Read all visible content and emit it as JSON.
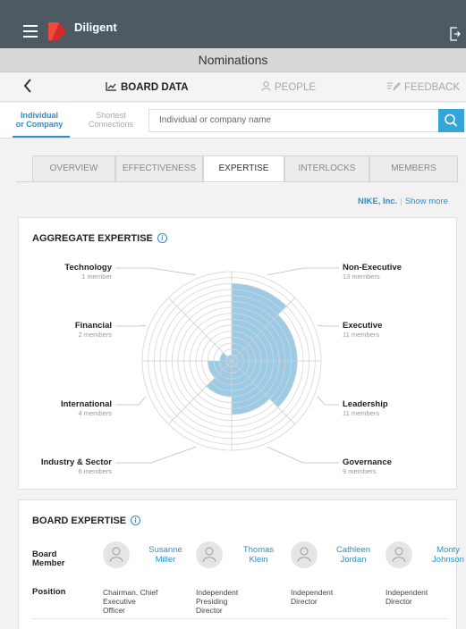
{
  "app": {
    "brand": "Diligent",
    "screen_title": "Nominations"
  },
  "nav": {
    "board_data": "BOARD DATA",
    "people": "PEOPLE",
    "feedback": "FEEDBACK"
  },
  "search": {
    "segment_individual_line1": "Individual",
    "segment_individual_line2": "or Company",
    "segment_shortest_line1": "Shortest",
    "segment_shortest_line2": "Connections",
    "placeholder": "Individual or company name"
  },
  "tabs": [
    "OVERVIEW",
    "EFFECTIVENESS",
    "EXPERTISE",
    "INTERLOCKS",
    "MEMBERS"
  ],
  "active_tab": "EXPERTISE",
  "company": {
    "name": "NIKE, Inc.",
    "separator": "|",
    "show_more": "Show more"
  },
  "aggregate": {
    "title": "AGGREGATE EXPERTISE",
    "info_symbol": "i",
    "ring_count": 15,
    "fill_color": "#9ccbe8",
    "sectors": [
      {
        "name": "Non-Executive",
        "count_text": "13 members",
        "value": 13
      },
      {
        "name": "Executive",
        "count_text": "11 members",
        "value": 11
      },
      {
        "name": "Leadership",
        "count_text": "11 members",
        "value": 11
      },
      {
        "name": "Governance",
        "count_text": "9 members",
        "value": 9
      },
      {
        "name": "Industry & Sector",
        "count_text": "6 members",
        "value": 6
      },
      {
        "name": "International",
        "count_text": "4 members",
        "value": 4
      },
      {
        "name": "Financial",
        "count_text": "2 members",
        "value": 2
      },
      {
        "name": "Technology",
        "count_text": "1 member",
        "value": 1
      }
    ]
  },
  "board": {
    "title": "BOARD EXPERTISE",
    "info_symbol": "i",
    "board_member_label_1": "Board",
    "board_member_label_2": "Member",
    "position_label": "Position",
    "members": [
      {
        "first": "Susanne",
        "last": "Miller",
        "position": [
          "Chairman, Chief",
          "Executive",
          "Officer"
        ]
      },
      {
        "first": "Thomas",
        "last": "Klein",
        "position": [
          "Independent",
          "Presiding",
          "Director"
        ]
      },
      {
        "first": "Cathleen",
        "last": "Jordan",
        "position": [
          "Independent",
          "Director"
        ]
      },
      {
        "first": "Monty",
        "last": "Johnson",
        "position": [
          "Independent",
          "Director"
        ]
      }
    ]
  },
  "colors": {
    "topbar": "#4d5a63",
    "accent": "#2a8fc9",
    "search_button": "#33a5d8",
    "logo_red": "#d32a2a"
  },
  "icons": [
    "menu-icon",
    "diligent-logo-icon",
    "logout-icon",
    "back-chevron-icon",
    "chart-line-icon",
    "person-outline-icon",
    "feedback-pencil-icon",
    "search-icon",
    "info-icon",
    "avatar-placeholder-icon"
  ]
}
